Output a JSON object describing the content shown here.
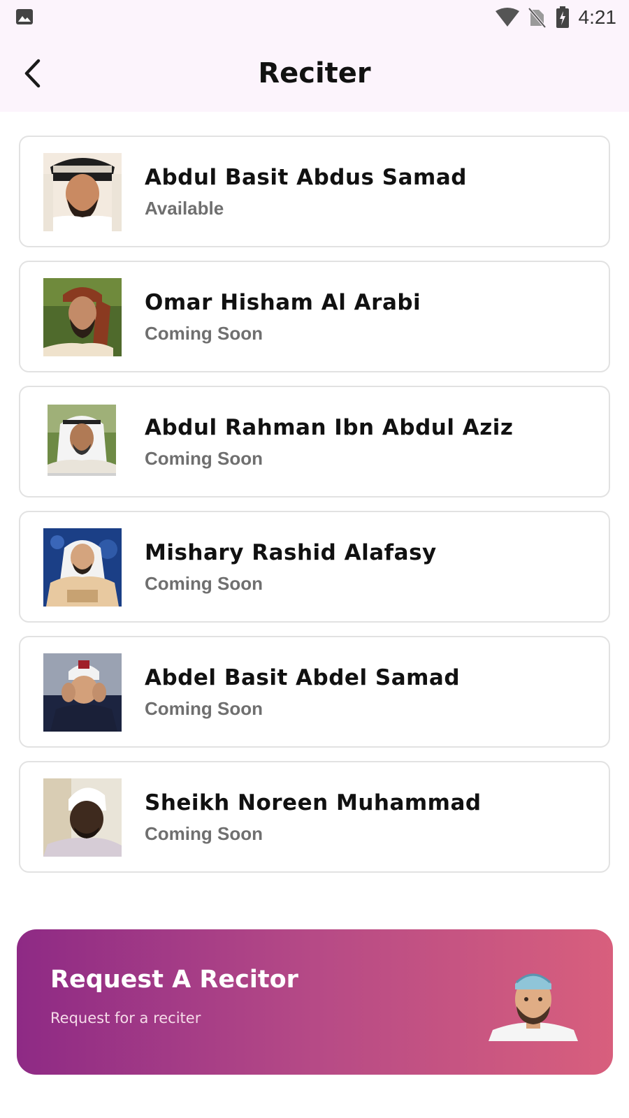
{
  "status_bar": {
    "time": "4:21",
    "icons": [
      "image-icon",
      "wifi-icon",
      "no-sim-icon",
      "battery-charging-icon"
    ]
  },
  "header": {
    "title": "Reciter",
    "back_icon": "back-arrow-icon"
  },
  "reciters": [
    {
      "name": "Abdul Basit Abdus Samad",
      "status": "Available"
    },
    {
      "name": "Omar Hisham Al Arabi",
      "status": "Coming Soon"
    },
    {
      "name": "Abdul Rahman Ibn Abdul Aziz",
      "status": "Coming Soon"
    },
    {
      "name": "Mishary Rashid Alafasy",
      "status": "Coming Soon"
    },
    {
      "name": "Abdel Basit Abdel Samad",
      "status": "Coming Soon"
    },
    {
      "name": "Sheikh Noreen Muhammad",
      "status": "Coming Soon"
    }
  ],
  "request_banner": {
    "title": "Request A Recitor",
    "subtitle": "Request for a reciter"
  },
  "colors": {
    "app_bar_bg": "#fcf4fc",
    "banner_gradient_start": "#8e2a85",
    "banner_gradient_end": "#d85f7d",
    "status_muted": "#6f6f6f"
  }
}
